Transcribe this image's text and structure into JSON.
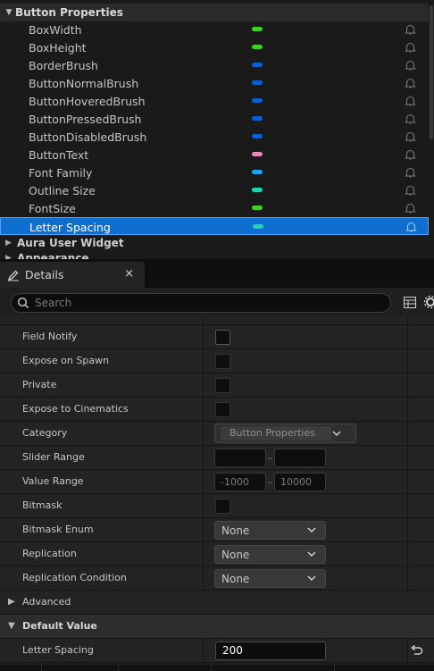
{
  "variables_panel": {
    "category": "Button Properties",
    "variables": [
      {
        "name": "BoxWidth",
        "type_color": "#3fd11f"
      },
      {
        "name": "BoxHeight",
        "type_color": "#3fd11f"
      },
      {
        "name": "BorderBrush",
        "type_color": "#0a5fd6"
      },
      {
        "name": "ButtonNormalBrush",
        "type_color": "#0a5fd6"
      },
      {
        "name": "ButtonHoveredBrush",
        "type_color": "#0a5fd6"
      },
      {
        "name": "ButtonPressedBrush",
        "type_color": "#0a5fd6"
      },
      {
        "name": "ButtonDisabledBrush",
        "type_color": "#0a5fd6"
      },
      {
        "name": "ButtonText",
        "type_color": "#e88ab8"
      },
      {
        "name": "Font Family",
        "type_color": "#1ea4ee"
      },
      {
        "name": "Outline Size",
        "type_color": "#1fd3b0"
      },
      {
        "name": "FontSize",
        "type_color": "#3fd11f"
      },
      {
        "name": "Letter Spacing",
        "type_color": "#1fd3b0"
      }
    ],
    "selected_index": 11,
    "sub_categories": [
      "Aura User Widget",
      "Appearance"
    ]
  },
  "details": {
    "tab_title": "Details",
    "close_glyph": "×",
    "search_placeholder": "Search",
    "properties": {
      "field_notify": "Field Notify",
      "expose_on_spawn": "Expose on Spawn",
      "private": "Private",
      "expose_to_cinematics": "Expose to Cinematics",
      "category": "Category",
      "category_value": "Button Properties",
      "slider_range": "Slider Range",
      "value_range": "Value Range",
      "value_range_min": "-1000",
      "value_range_max": "10000",
      "range_sep": "..",
      "bitmask": "Bitmask",
      "bitmask_enum": "Bitmask Enum",
      "bitmask_enum_value": "None",
      "replication": "Replication",
      "replication_value": "None",
      "replication_condition": "Replication Condition",
      "replication_condition_value": "None"
    },
    "advanced_label": "Advanced",
    "default_value_label": "Default Value",
    "default_value_field": "Letter Spacing",
    "default_value": "200"
  },
  "colors": {
    "selection": "#0f6fd1",
    "panel_bg": "#1a1a1a"
  }
}
